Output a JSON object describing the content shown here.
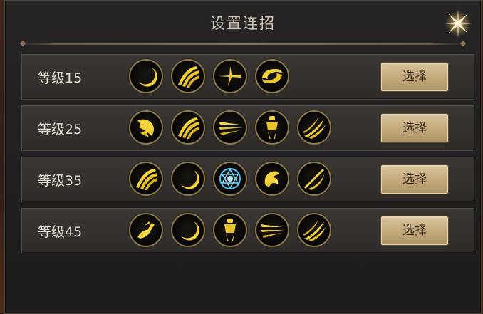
{
  "dialog": {
    "title": "设置连招"
  },
  "rows": [
    {
      "label": "等级15",
      "button": "选择",
      "skills": [
        "crescent-slash-icon",
        "claw-swipe-icon",
        "sword-thrust-icon",
        "whirlwind-icon"
      ]
    },
    {
      "label": "等级25",
      "button": "选择",
      "skills": [
        "burst-strike-icon",
        "claw-swipe-icon",
        "triple-dash-icon",
        "warrior-stance-icon",
        "flame-sweep-icon"
      ]
    },
    {
      "label": "等级35",
      "button": "选择",
      "skills": [
        "claw-swipe-icon",
        "crescent-slash-icon",
        "hexagram-seal-icon",
        "dragon-roar-icon",
        "blade-cleave-icon"
      ]
    },
    {
      "label": "等级45",
      "button": "选择",
      "skills": [
        "leaping-strike-icon",
        "crescent-slash-icon",
        "warrior-stance-icon",
        "triple-dash-icon",
        "flame-sweep-icon"
      ]
    }
  ],
  "colors": {
    "skill_gold": "#f2d23a",
    "skill_blue": "#4fc3f7",
    "button_text": "#3a2a18"
  }
}
